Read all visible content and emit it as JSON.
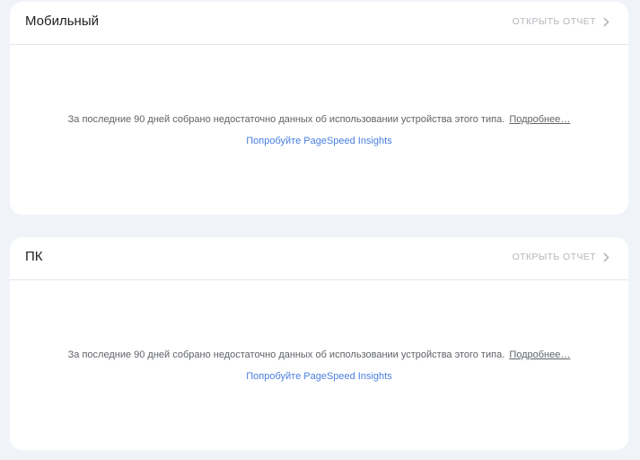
{
  "cards": {
    "mobile": {
      "title": "Мобильный",
      "open_report": "ОТКРЫТЬ ОТЧЕТ",
      "message": "За последние 90 дней собрано недостаточно данных об использовании устройства этого типа.",
      "more_link": "Подробнее…",
      "psi_link": "Попробуйте PageSpeed Insights"
    },
    "desktop": {
      "title": "ПК",
      "open_report": "ОТКРЫТЬ ОТЧЕТ",
      "message": "За последние 90 дней собрано недостаточно данных об использовании устройства этого типа.",
      "more_link": "Подробнее…",
      "psi_link": "Попробуйте PageSpeed Insights"
    }
  },
  "icons": {
    "open_report": "chevron-right-icon"
  },
  "colors": {
    "background": "#f0f4f9",
    "card": "#ffffff",
    "link": "#4a7fe0",
    "muted": "#b4b8bd"
  }
}
